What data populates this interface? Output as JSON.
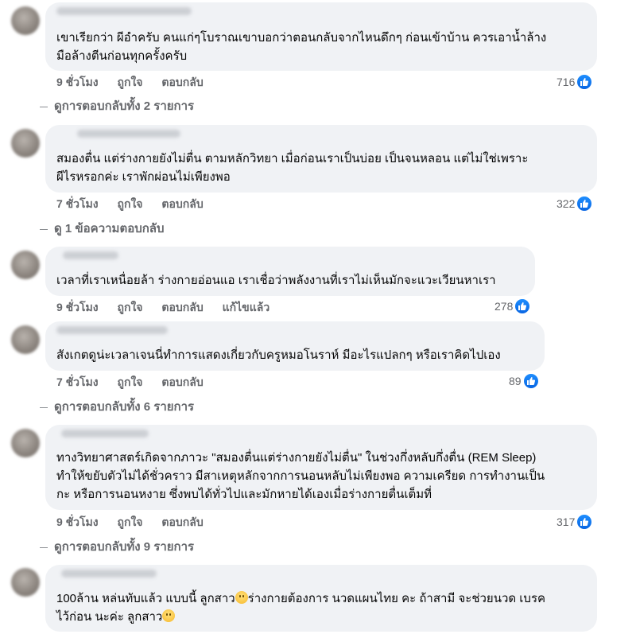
{
  "colors": {
    "bubble_bg": "#f0f2f5",
    "secondary_text": "#65676b",
    "like_blue": "#1877f2"
  },
  "comments": [
    {
      "text": "เขาเรียกว่า ผีอำครับ คนแก่ๆโบราณเขาบอกว่าตอนกลับจากไหนดึกๆ ก่อนเข้าบ้าน ควรเอาน้ำล้าง\nมือล้างตีนก่อนทุกครั้งครับ",
      "time": "9 ชั่วโมง",
      "like": "ถูกใจ",
      "reply": "ตอบกลับ",
      "edited": "",
      "reactions": "716",
      "view_replies": "ดูการตอบกลับทั้ง 2 รายการ"
    },
    {
      "text": "สมองตื่น แต่ร่างกายยังไม่ตื่น ตามหลักวิทยา เมื่อก่อนเราเป็นบ่อย เป็นจนหลอน แต่ไม่ใช่เพราะ\nผีไรหรอกค่ะ เราพักผ่อนไม่เพียงพอ",
      "time": "7 ชั่วโมง",
      "like": "ถูกใจ",
      "reply": "ตอบกลับ",
      "edited": "",
      "reactions": "322",
      "view_replies": "ดู 1 ข้อความตอบกลับ"
    },
    {
      "text": "เวลาที่เราเหนื่อยล้า ร่างกายอ่อนแอ เราเชื่อว่าพลังงานที่เราไม่เห็นมักจะแวะเวียนหาเรา",
      "time": "9 ชั่วโมง",
      "like": "ถูกใจ",
      "reply": "ตอบกลับ",
      "edited": "แก้ไขแล้ว",
      "reactions": "278",
      "view_replies": ""
    },
    {
      "text": "สังเกตดูน่ะเวลาเจนนี่ทำการแสดงเกี่ยวกับครูหมอโนราห์ มีอะไรแปลกๆ หรือเราคิดไปเอง",
      "time": "7 ชั่วโมง",
      "like": "ถูกใจ",
      "reply": "ตอบกลับ",
      "edited": "",
      "reactions": "89",
      "view_replies": "ดูการตอบกลับทั้ง 6 รายการ"
    },
    {
      "text": "ทางวิทยาศาสตร์เกิดจากภาวะ \"สมองตื่นแต่ร่างกายยังไม่ตื่น\" ในช่วงกึ่งหลับกึ่งตื่น (REM Sleep)\nทำให้ขยับตัวไม่ได้ชั่วคราว มีสาเหตุหลักจากการนอนหลับไม่เพียงพอ ความเครียด การทำงานเป็น\nกะ หรือการนอนหงาย ซึ่งพบได้ทั่วไปและมักหายได้เองเมื่อร่างกายตื่นเต็มที่",
      "time": "9 ชั่วโมง",
      "like": "ถูกใจ",
      "reply": "ตอบกลับ",
      "edited": "",
      "reactions": "317",
      "view_replies": "ดูการตอบกลับทั้ง 9 รายการ"
    },
    {
      "text_a": "100ล้าน หล่นทับแล้ว แบบนี้ ลูกสาว",
      "text_b": "ร่างกายต้องการ นวดแผนไทย คะ ถ้าสามี จะช่วยนวด เบรค",
      "text_c": "ไว้ก่อน นะค่ะ ลูกสาว",
      "emoji_icon": "hushed-face-emoji"
    }
  ]
}
